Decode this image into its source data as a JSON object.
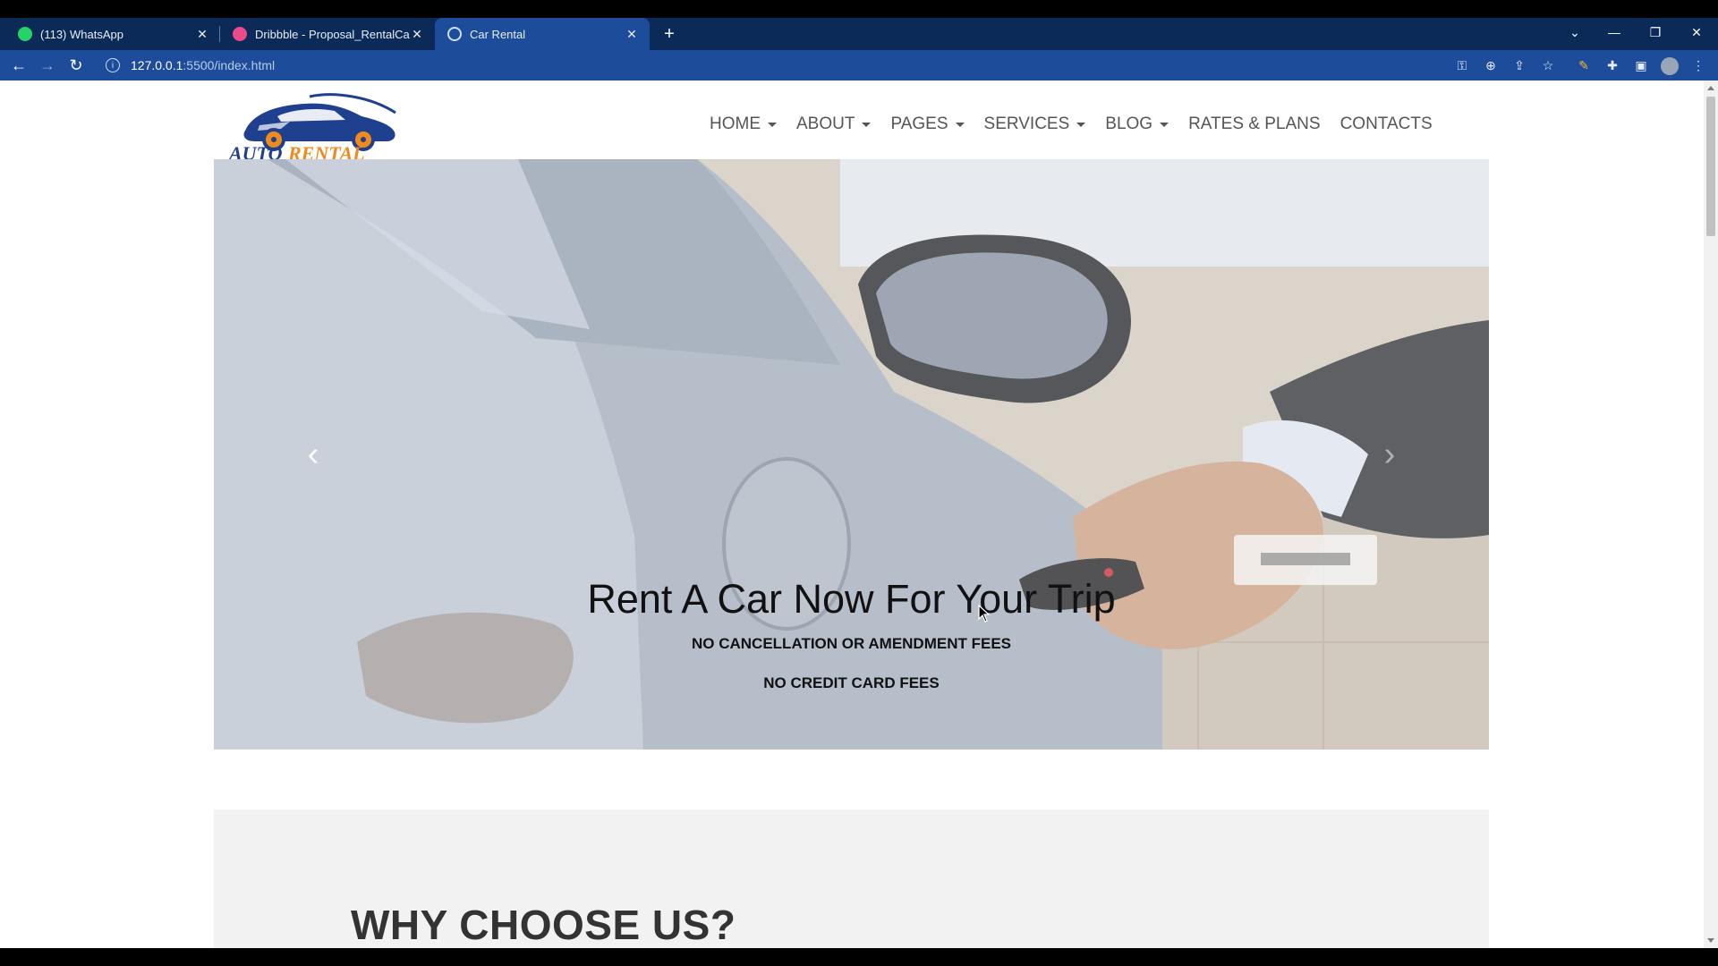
{
  "browser": {
    "tabs": [
      {
        "title": "(113) WhatsApp",
        "favicon": "whatsapp-icon",
        "color": "#25d366"
      },
      {
        "title": "Dribbble - Proposal_RentalCar.png",
        "favicon": "dribbble-icon",
        "color": "#ea4c89"
      },
      {
        "title": "Car Rental",
        "favicon": "globe-icon",
        "color": "#cfe0fa"
      }
    ],
    "url_host": "127.0.0.1",
    "url_path": ":5500/index.html"
  },
  "site": {
    "logo_text_auto": "AUTO",
    "logo_text_rental": "RENTAL",
    "menu": [
      {
        "label": "HOME",
        "dropdown": true
      },
      {
        "label": "ABOUT",
        "dropdown": true
      },
      {
        "label": "PAGES",
        "dropdown": true
      },
      {
        "label": "SERVICES",
        "dropdown": true
      },
      {
        "label": "BLOG",
        "dropdown": true
      },
      {
        "label": "RATES & PLANS",
        "dropdown": false
      },
      {
        "label": "CONTACTS",
        "dropdown": false
      }
    ],
    "hero": {
      "title": "Rent A Car Now For Your Trip",
      "line1": "NO CANCELLATION OR AMENDMENT FEES",
      "line2": "NO CREDIT CARD FEES"
    },
    "why": {
      "title": "WHY CHOOSE US?"
    }
  },
  "colors": {
    "chrome_dark": "#0b2a57",
    "chrome_active": "#1d4c9a",
    "logo_blue": "#1f3f8f",
    "logo_orange": "#f08a1c"
  }
}
